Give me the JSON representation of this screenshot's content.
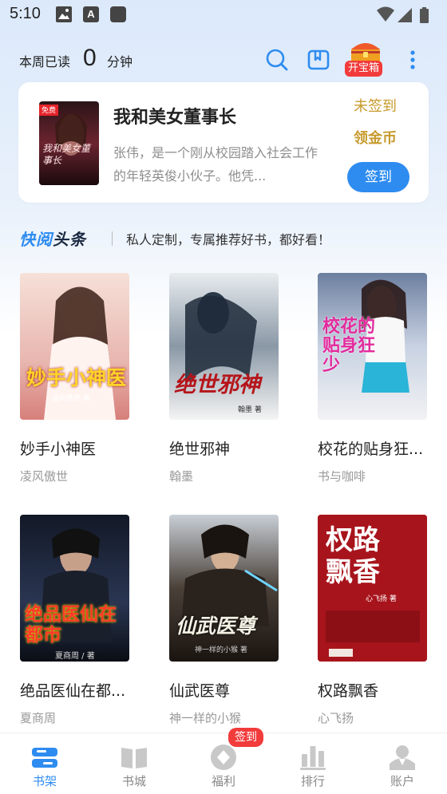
{
  "status_bar": {
    "time": "5:10",
    "icons": [
      "image-icon",
      "a-icon",
      "square-icon",
      "wifi-icon",
      "signal-icon",
      "battery-icon"
    ]
  },
  "header": {
    "read_label": "本周已读",
    "read_value": "0",
    "read_unit": "分钟",
    "treasure_label": "开宝箱"
  },
  "featured": {
    "cover_tag": "免费",
    "cover_text": "我和美女董事长",
    "title": "我和美女董事长",
    "description": "张伟，是一个刚从校园踏入社会工作的年轻英俊小伙子。他凭...",
    "signin_status": "未签到",
    "gold_label": "领金币",
    "signin_button": "签到"
  },
  "section": {
    "logo_part1": "快阅",
    "logo_part2": "头条",
    "description": "私人定制，专属推荐好书，都好看！"
  },
  "books": [
    {
      "title": "妙手小神医",
      "author": "凌风傲世",
      "cover_text": "妙手小神医",
      "cover_sub": "凌风傲世 著"
    },
    {
      "title": "绝世邪神",
      "author": "翰墨",
      "cover_text": "绝世邪神",
      "cover_sub": "翰墨 著"
    },
    {
      "title": "校花的贴身狂...",
      "author": "书与咖啡",
      "cover_text": "校花的贴身狂少",
      "cover_sub": ""
    },
    {
      "title": "绝品医仙在都...",
      "author": "夏商周",
      "cover_text": "绝品医仙在都市",
      "cover_sub": "夏商周 / 著"
    },
    {
      "title": "仙武医尊",
      "author": "神一样的小猴",
      "cover_text": "仙武医尊",
      "cover_sub": "神一样的小猴 著"
    },
    {
      "title": "权路飘香",
      "author": "心飞扬",
      "cover_text": "权路飘香",
      "cover_sub": "心飞扬 著"
    }
  ],
  "tabs": [
    {
      "label": "书架",
      "icon": "bookshelf-icon",
      "active": true
    },
    {
      "label": "书城",
      "icon": "bookstore-icon",
      "active": false
    },
    {
      "label": "福利",
      "icon": "welfare-icon",
      "active": false
    },
    {
      "label": "排行",
      "icon": "ranking-icon",
      "active": false
    },
    {
      "label": "账户",
      "icon": "account-icon",
      "active": false
    }
  ],
  "tab_badge": "签到",
  "colors": {
    "accent": "#2e8cf0",
    "gold": "#c79a2d",
    "badge": "#f23b3b"
  }
}
